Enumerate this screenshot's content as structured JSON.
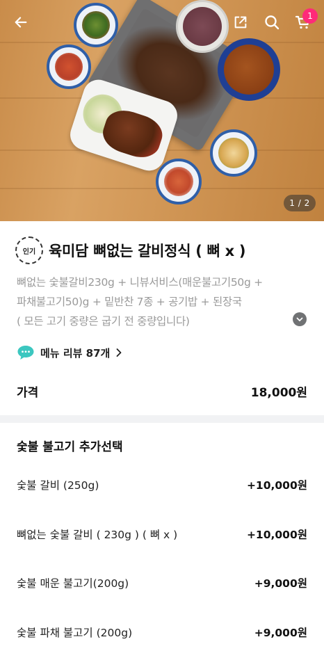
{
  "hero": {
    "pager": "1 / 2",
    "cart_count": "1",
    "icons": [
      "back-arrow-icon",
      "share-icon",
      "search-icon",
      "cart-icon"
    ]
  },
  "product": {
    "badge": "인기",
    "title": "육미담 뼈없는 갈비정식 ( 뼈 x )",
    "description_lines": [
      "뼈없는 숯불갈비230g + 니뷰서비스(매운불고기50g +",
      "파채불고기50)g + 밑반찬 7종 + 공기밥 + 된장국",
      "( 모든 고기 중량은 굽기 전 중량입니다)"
    ],
    "review_label": "메뉴 리뷰 87개",
    "price_label": "가격",
    "price_value": "18,000원"
  },
  "options": {
    "section_title": "숯불 불고기 추가선택",
    "items": [
      {
        "name": "숯불 갈비 (250g)",
        "price": "+10,000원"
      },
      {
        "name": "뼈없는 숯불 갈비 ( 230g ) ( 뼈 x )",
        "price": "+10,000원"
      },
      {
        "name": "숯불 매운 불고기(200g)",
        "price": "+9,000원"
      },
      {
        "name": "숯불 파채 불고기 (200g)",
        "price": "+9,000원"
      }
    ]
  },
  "colors": {
    "badge_pink": "#ff2a79",
    "review_icon": "#3cc7c0",
    "divider": "#f1f2f4",
    "muted_text": "#9a9a9a"
  }
}
